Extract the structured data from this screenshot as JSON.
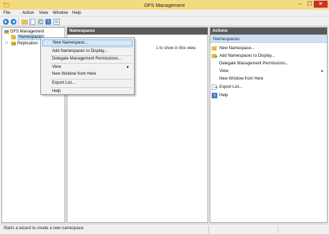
{
  "window": {
    "title": "DFS Management",
    "minimize_glyph": "–",
    "maximize_glyph": "☐",
    "close_glyph": "✕",
    "titlebar_color": "#f3db80",
    "close_color": "#c7322b"
  },
  "menubar": {
    "items": [
      "File",
      "Action",
      "View",
      "Window",
      "Help"
    ]
  },
  "toolbar": {
    "icons": [
      "back-arrow-icon",
      "forward-arrow-icon",
      "folder-up-icon",
      "show-hide-tree-icon",
      "refresh-icon",
      "help-icon",
      "properties-icon"
    ]
  },
  "tree": {
    "root": "DFS Management",
    "items": [
      "Namespaces",
      "Replication"
    ]
  },
  "center": {
    "header": "Namespaces",
    "body_text": "s to show in this view."
  },
  "actions": {
    "header": "Actions",
    "subheader": "Namespaces",
    "items": [
      {
        "label": "New Namespace...",
        "icon": "new-namespace-icon"
      },
      {
        "label": "Add Namespaces to Display...",
        "icon": "add-namespaces-icon"
      },
      {
        "label": "Delegate Management Permissions...",
        "icon": ""
      },
      {
        "label": "View",
        "icon": "",
        "submenu": "►"
      },
      {
        "label": "New Window from Here",
        "icon": ""
      },
      {
        "label": "Export List...",
        "icon": "export-list-icon"
      },
      {
        "label": "Help",
        "icon": "help-icon"
      }
    ]
  },
  "context_menu": {
    "items": [
      "New Namespace...",
      "Add Namespaces to Display...",
      "Delegate Management Permissions...",
      "View",
      "New Window from Here",
      "Export List...",
      "Help"
    ],
    "highlighted": "New Namespace...",
    "submenu_arrow": "►",
    "highlight_color": "#d5e8fa"
  },
  "statusbar": {
    "text": "Starts a wizard to create a new namespace."
  },
  "colors": {
    "pane_header": "#5a5a5a",
    "actions_subheader": "#cfe0f3",
    "selection": "#cce4f7"
  }
}
